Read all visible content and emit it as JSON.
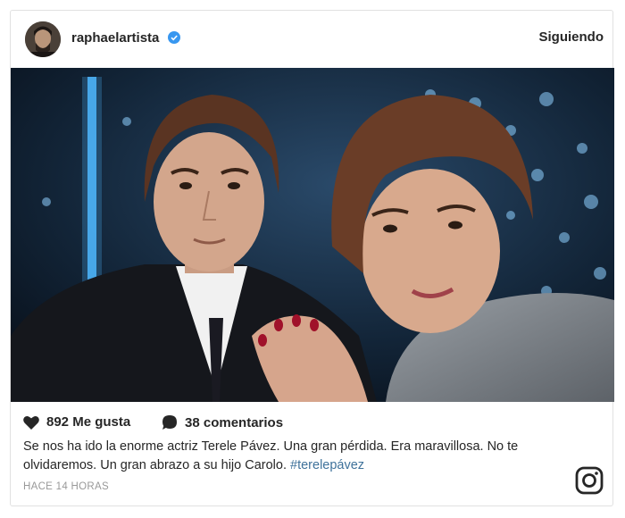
{
  "post": {
    "username": "raphaelartista",
    "verified_icon": "verified-badge-icon",
    "follow_label": "Siguiendo",
    "likes_text": "892 Me gusta",
    "comments_text": "38 comentarios",
    "caption_text": "Se nos ha ido la enorme actriz Terele Pávez. Una gran pérdida. Era maravillosa. No te olvidaremos. Un gran abrazo a su hijo Carolo. ",
    "hashtag": "#terelepávez",
    "time_ago": "HACE 14 HORAS",
    "logo_icon": "instagram-logo-icon"
  },
  "colors": {
    "verified_blue": "#3897f0",
    "hashtag": "#3f729b",
    "meta_gray": "#999999",
    "text": "#262626"
  }
}
